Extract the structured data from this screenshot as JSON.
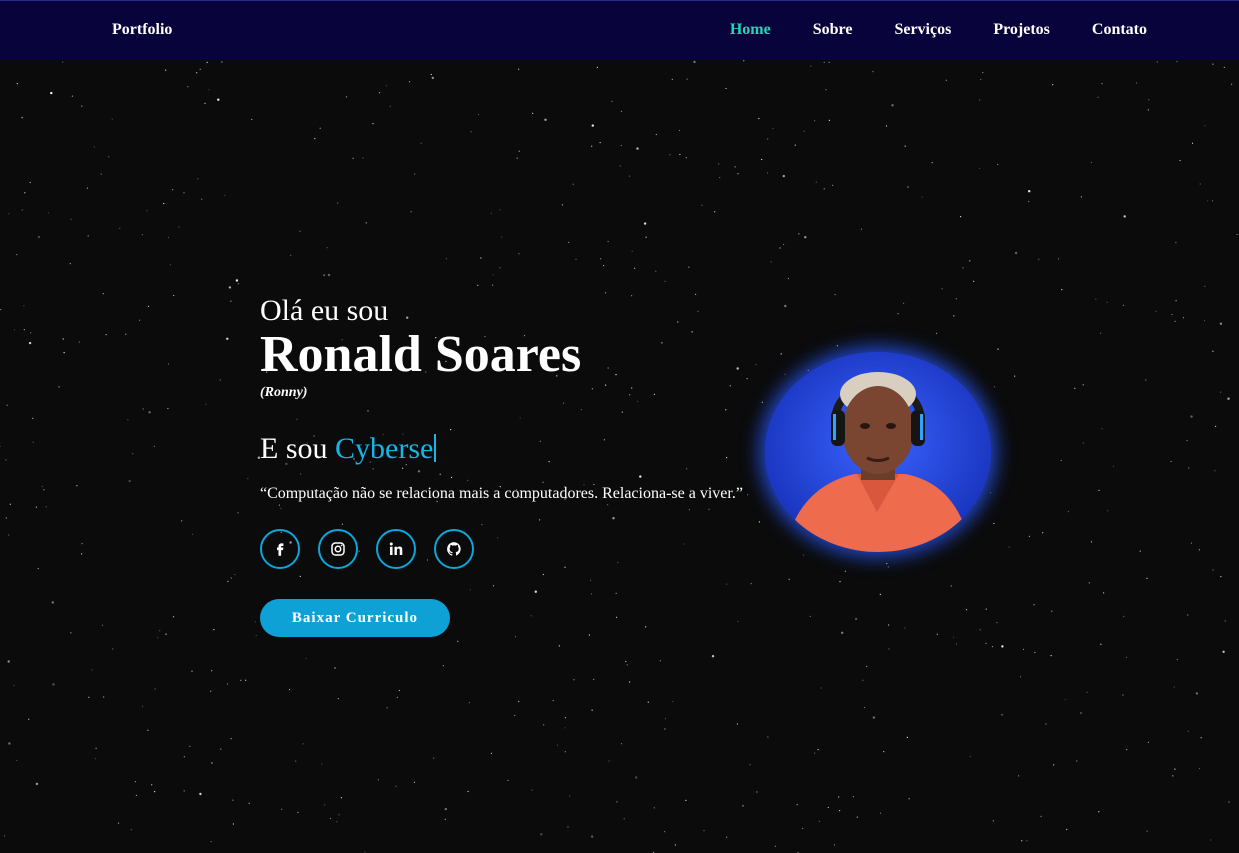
{
  "brand": "Portfolio",
  "nav": [
    {
      "label": "Home",
      "active": true
    },
    {
      "label": "Sobre",
      "active": false
    },
    {
      "label": "Serviços",
      "active": false
    },
    {
      "label": "Projetos",
      "active": false
    },
    {
      "label": "Contato",
      "active": false
    }
  ],
  "hero": {
    "greeting": "Olá eu sou",
    "name": "Ronald Soares",
    "nickname": "(Ronny)",
    "role_prefix": "E sou",
    "role_typed": "Cyberse",
    "quote": "“Computação não se relaciona mais a computadores. Relaciona-se a viver.”",
    "cv_button": "Baixar Curriculo"
  },
  "socials": [
    {
      "icon": "facebook-icon"
    },
    {
      "icon": "instagram-icon"
    },
    {
      "icon": "linkedin-icon"
    },
    {
      "icon": "github-icon"
    }
  ],
  "colors": {
    "navbar": "#08033a",
    "accent_nav": "#1fd8b8",
    "accent": "#13b6e6",
    "button": "#0ea1d6",
    "avatar_glow": "#285aff"
  }
}
